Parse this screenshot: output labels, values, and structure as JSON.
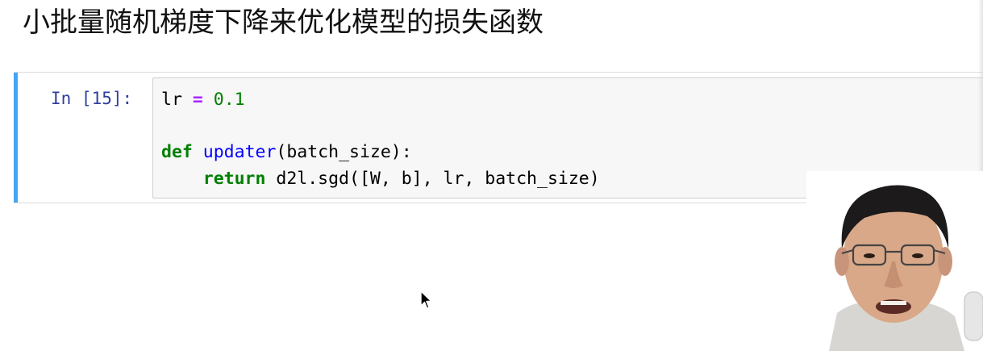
{
  "heading": {
    "text": "小批量随机梯度下降来优化模型的损失函数"
  },
  "cell": {
    "prompt": "In [15]:",
    "code": {
      "line1": {
        "ident": "lr",
        "op": "=",
        "num": "0.1"
      },
      "line3": {
        "kw": "def",
        "fname": "updater",
        "rest": "(batch_size):"
      },
      "line4": {
        "indent": "    ",
        "kw": "return",
        "rest": " d2l.sgd([W, b], lr, batch_size)"
      }
    }
  },
  "colors": {
    "selection_bar": "#42a5f5",
    "prompt": "#303f9f",
    "keyword": "#008000",
    "function_name": "#0000ff",
    "operator": "#aa22ff",
    "number": "#008000",
    "code_background": "#f7f7f7"
  },
  "icons": {
    "cursor": "mouse-pointer-icon"
  },
  "video_overlay": {
    "description_icon": "presenter-webcam"
  }
}
